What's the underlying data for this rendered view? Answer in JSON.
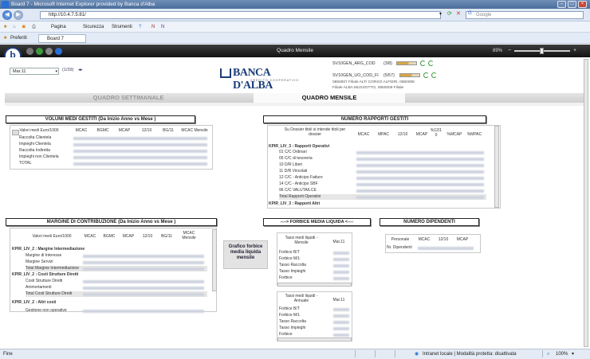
{
  "window": {
    "title": "Board 7 - Microsoft Internet Explorer provided by Banca d'Alba"
  },
  "browser": {
    "url": "http://10.4.7.5:81/",
    "search_placeholder": "Google",
    "menu": {
      "page": "Pagina",
      "security": "Sicurezza",
      "tools": "Strumenti"
    },
    "favorites_label": "Preferiti",
    "tab_label": "Board 7"
  },
  "app": {
    "title": "Quadro Mensile",
    "zoom": "89%",
    "logo_letter": "b",
    "period": {
      "selected": "Mar.11",
      "pager": "(1/39)"
    },
    "bank": {
      "name": "BANCA D'ALBA",
      "sub": "CREDITO COOPERATIVO"
    },
    "filters": [
      {
        "label": "SV10GEN_ARG_COD",
        "count": "(3/8)"
      },
      {
        "label": "SV10GEN_UO_COD_FI",
        "count": "(5/57)"
      }
    ],
    "filter_info": [
      "0850007 Filiale ALTI CORSO ALFIERI, 0850008",
      "Filiale ALBA MUSSOTTO, 0850009 Filiale"
    ],
    "tabs": {
      "weekly": "QUADRO SETTIMANALE",
      "monthly": "QUADRO MENSILE"
    }
  },
  "volumi": {
    "title": "VOLUMI MEDI GESTITI  (Da Inizio Anno vs Mese )",
    "headers": [
      "Valori medi Euro/1000",
      "MCAC",
      "BGMC",
      "MCAP",
      "12/10",
      "BG/11",
      "MCAC Mensile"
    ],
    "rows": [
      "Raccolta Clientela",
      "Impieghi Clientela",
      "Raccolta Indiretta",
      "Impieghi non Clientela",
      "TOTAL"
    ]
  },
  "rapporti": {
    "title": "NUMERO RAPPORTI GESTITI",
    "headers": [
      "Su Dossier titoli si intende titoli per dossier",
      "MCAC",
      "MPAC",
      "12/10",
      "MCAP",
      "%12/1 0",
      "%MCAP",
      "%MPAC"
    ],
    "group1": "KPIR_LIV_3 : Rapporti Operativi",
    "rows": [
      "01 C/C Ordinari",
      "05 C/C di tesoreria",
      "10 D/R Liberi",
      "11 D/R Vincolati",
      "12 C/C - Anticipo Fatture",
      "14 C/C - Anticipo SBF",
      "96 C/C VALUTA/LCE",
      "Total Rapporti Operativi"
    ],
    "group2": "KPIR_LIV_3 : Rapporti Altri"
  },
  "margine": {
    "title": "MARGINE DI CONTRIBUZIONE (Da Inizio Anno vs Mese )",
    "headers": [
      "Valori medi Euro/1000",
      "MCAC",
      "BGMC",
      "MCAP",
      "12/10",
      "BG/11",
      "MCAC Mensile"
    ],
    "group1": "KPIR_LIV_2 : Margine Intermediazione",
    "rows1": [
      "Margine di Interesse",
      "Margine Servizi",
      "Total Margine Intermediazione"
    ],
    "group2": "KPIR_LIV_2 : Costi Strutture Diretti",
    "rows2": [
      "Costi Strutture Diretti",
      "Ammortamenti",
      "Total Costi Strutture Diretti"
    ],
    "group3": "KPIR_LIV_2 : Altri costi",
    "rows3": [
      "Gestione non operative"
    ]
  },
  "forbice": {
    "title": "----> FORBICE MEDIA LIQUIDA <----",
    "chart_button": "Grafico forbice media liquida mensile",
    "table1": {
      "header": "Tassi medi liquidi - Mensile",
      "col": "Mar.11",
      "rows": [
        "Forbice B/T",
        "Forbice M/L",
        "Tasso Raccolta",
        "Tasso Impieghi",
        "Forbice"
      ]
    },
    "table2": {
      "header": "Tassi medi liquidi - Annuale",
      "col": "Mar.11",
      "rows": [
        "Forbice B/T",
        "Forbice M/L",
        "Tasso Raccolta",
        "Tasso Impieghi",
        "Forbice"
      ]
    }
  },
  "dipendenti": {
    "title": "NUMERO DIPENDENTI",
    "headers": [
      "Personale",
      "MCAC",
      "12/10",
      "MCAP"
    ],
    "rows": [
      "Nr. Dipendenti"
    ]
  },
  "status": {
    "left": "Fine",
    "zone": "Intranet locale | Modalità protetta: disattivata",
    "zoom": "100%"
  }
}
